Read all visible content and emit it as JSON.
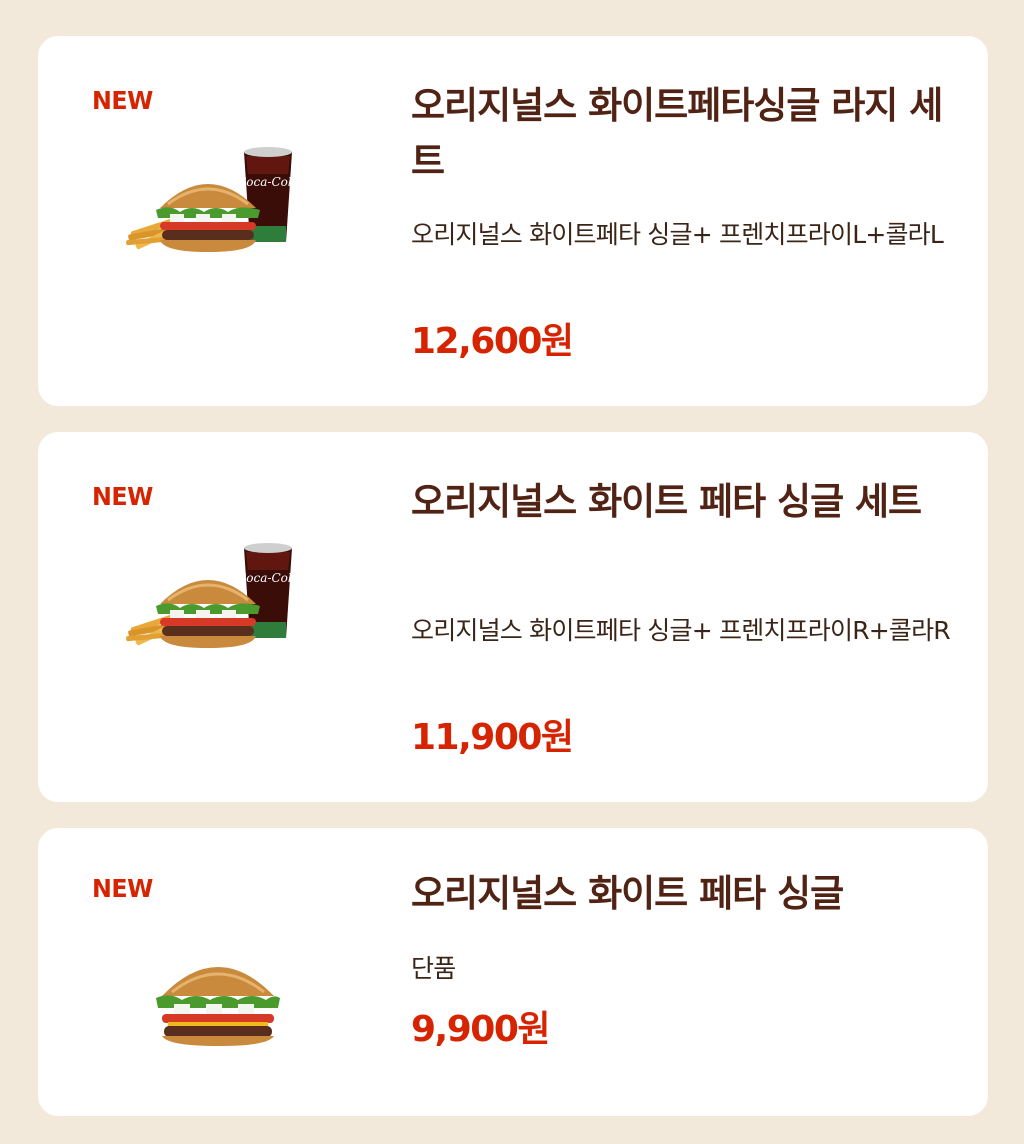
{
  "colors": {
    "background": "#f3e9db",
    "card": "#ffffff",
    "title": "#502314",
    "accent": "#d62300"
  },
  "products": [
    {
      "badge": "NEW",
      "title": "오리지널스 화이트페타싱글 라지 세트",
      "description": "오리지널스 화이트페타 싱글+ 프렌치프라이L+콜라L",
      "price": "12,600원",
      "image_icon": "burger-set-image",
      "cup_text": "Coca-Cola"
    },
    {
      "badge": "NEW",
      "title": "오리지널스 화이트 페타 싱글 세트",
      "description": "오리지널스 화이트페타 싱글+ 프렌치프라이R+콜라R",
      "price": "11,900원",
      "image_icon": "burger-set-image",
      "cup_text": "Coca-Cola"
    },
    {
      "badge": "NEW",
      "title": "오리지널스 화이트 페타 싱글",
      "description": "단품",
      "price": "9,900원",
      "image_icon": "burger-image"
    }
  ]
}
